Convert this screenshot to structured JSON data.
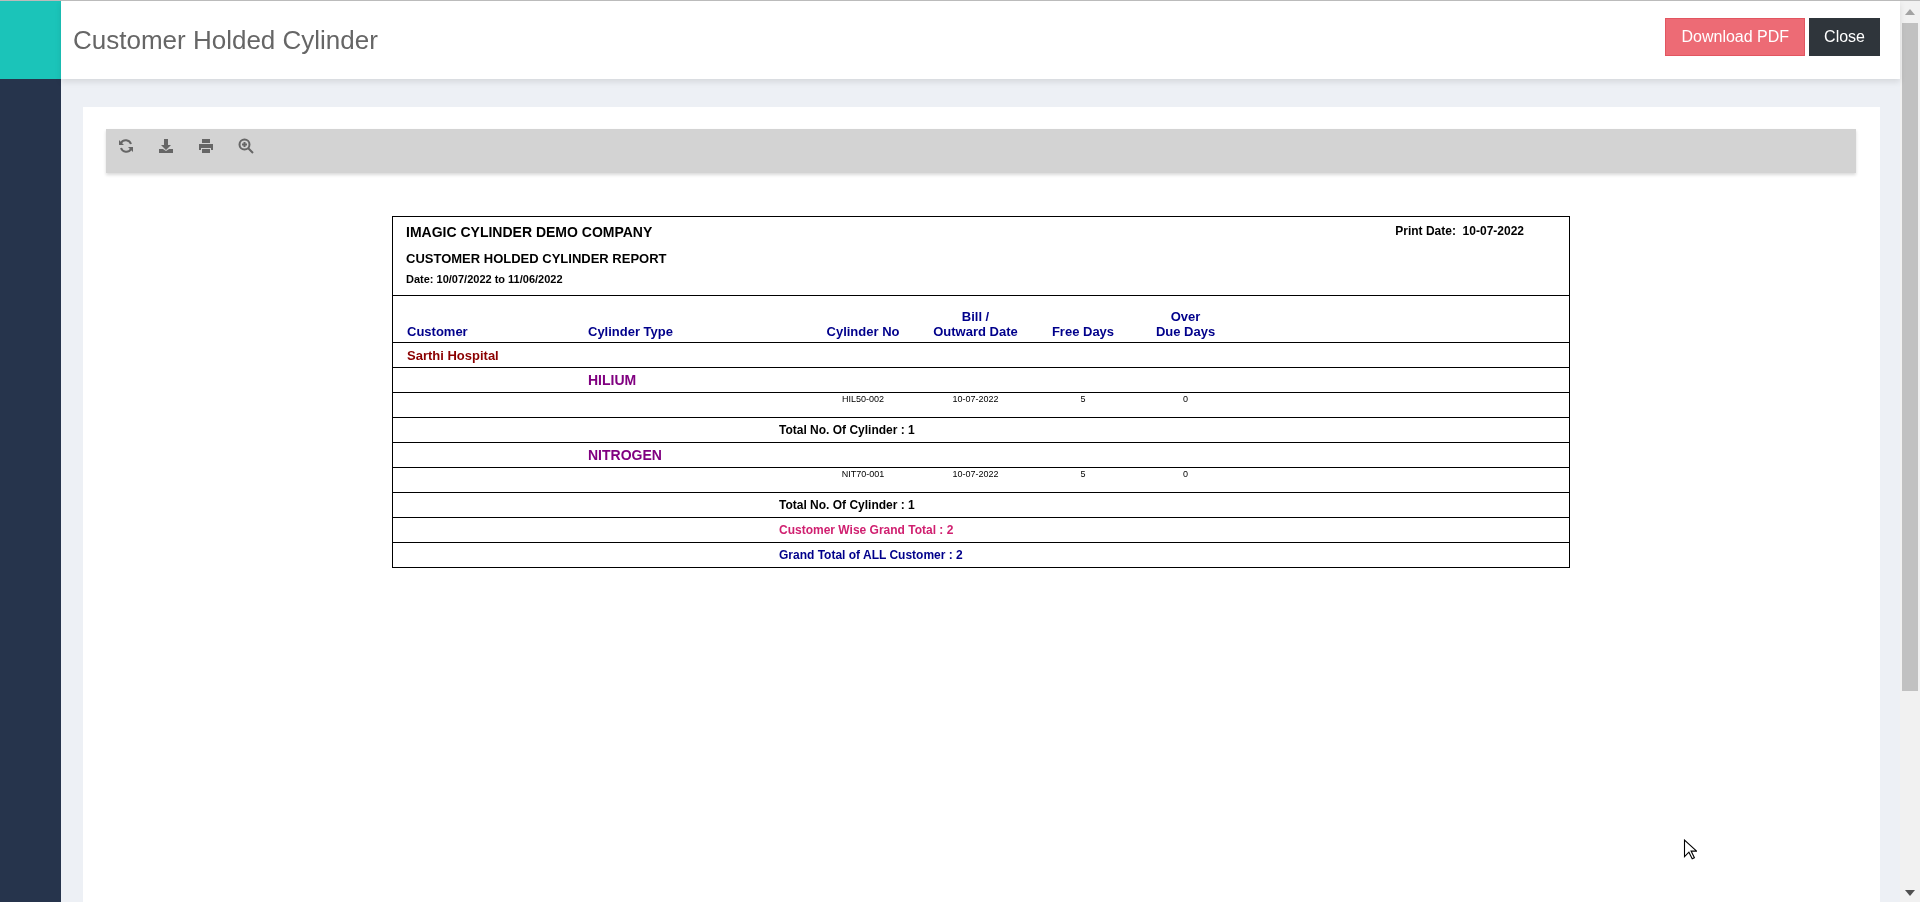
{
  "header": {
    "title": "Customer Holded Cylinder",
    "buttons": [
      {
        "label": "Download PDF",
        "kind": "primary"
      },
      {
        "label": "Close",
        "kind": "dark"
      }
    ]
  },
  "toolbar": {
    "tools": [
      {
        "kind": "refresh"
      },
      {
        "kind": "download"
      },
      {
        "kind": "print"
      },
      {
        "kind": "zoom"
      }
    ]
  },
  "report": {
    "company": "IMAGIC CYLINDER DEMO COMPANY",
    "print_date_label": "Print Date:",
    "print_date": "10-07-2022",
    "title": "CUSTOMER HOLDED CYLINDER REPORT",
    "date_label": "Date:",
    "date_range": "10/07/2022 to 11/06/2022",
    "columns": [
      [
        "Customer"
      ],
      [
        "Cylinder Type"
      ],
      [
        "Cylinder No"
      ],
      [
        "Bill /",
        "Outward Date"
      ],
      [
        "Free Days"
      ],
      [
        "Over",
        "Due Days"
      ]
    ],
    "rows": [
      {
        "kind": "customer",
        "text": "Sarthi Hospital"
      },
      {
        "kind": "type",
        "text": "HILIUM"
      },
      {
        "kind": "item",
        "cylinder_no": "HIL50-002",
        "date": "10-07-2022",
        "free_days": "5",
        "over_due_days": "0"
      },
      {
        "kind": "subtotal",
        "text": "Total No. Of Cylinder : 1"
      },
      {
        "kind": "type",
        "text": "NITROGEN"
      },
      {
        "kind": "item",
        "cylinder_no": "NIT70-001",
        "date": "10-07-2022",
        "free_days": "5",
        "over_due_days": "0"
      },
      {
        "kind": "subtotal",
        "text": "Total No. Of Cylinder : 1"
      },
      {
        "kind": "customer_total",
        "text": "Customer Wise Grand Total : 2"
      },
      {
        "kind": "grand_total",
        "text": "Grand Total of ALL Customer : 2"
      }
    ]
  }
}
